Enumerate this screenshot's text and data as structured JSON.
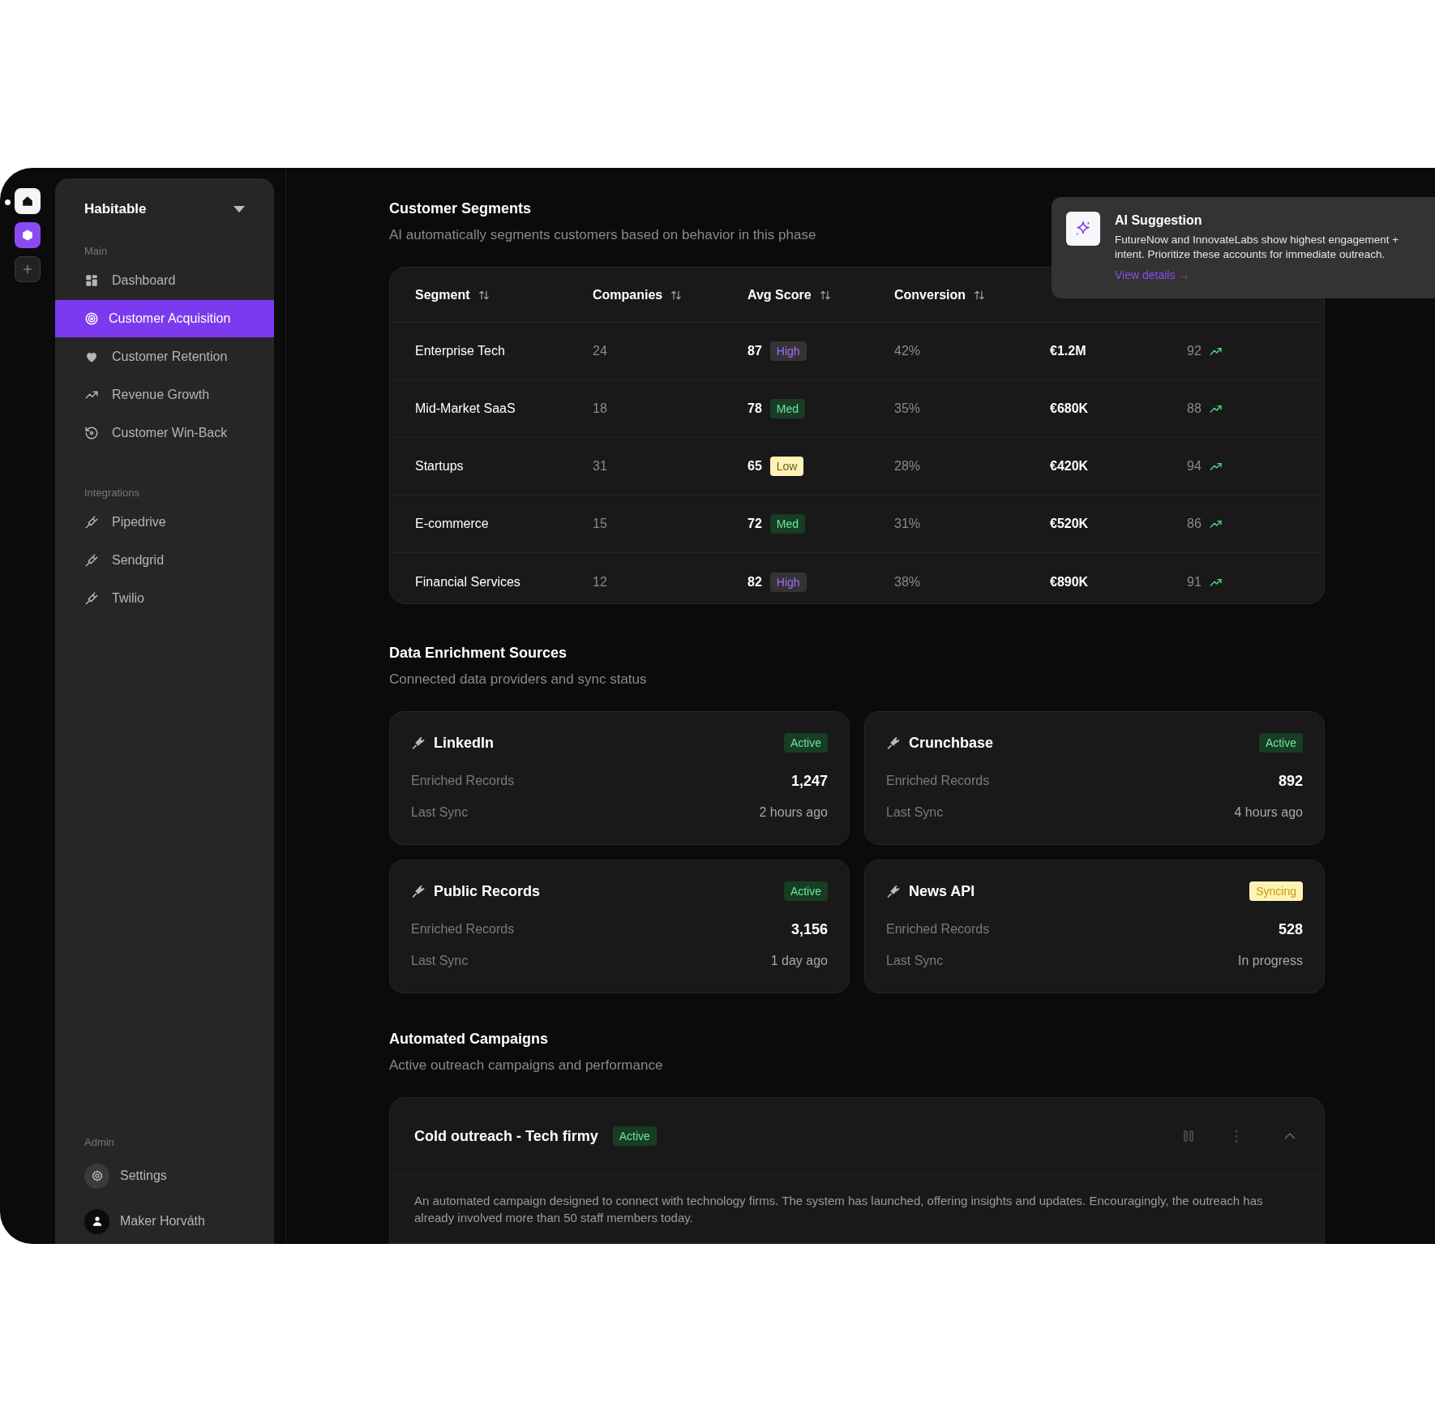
{
  "rail": {
    "items": [
      {
        "kind": "home"
      },
      {
        "kind": "workspace"
      },
      {
        "kind": "add"
      }
    ]
  },
  "sidebar": {
    "workspace": "Habitable",
    "sections": [
      {
        "label": "Main",
        "items": [
          {
            "label": "Dashboard",
            "selected": false
          },
          {
            "label": "Customer Acquisition",
            "selected": true
          },
          {
            "label": "Customer Retention",
            "selected": false
          },
          {
            "label": "Revenue Growth",
            "selected": false
          },
          {
            "label": "Customer Win-Back",
            "selected": false
          }
        ]
      },
      {
        "label": "Integrations",
        "items": [
          {
            "label": "Pipedrive",
            "selected": false
          },
          {
            "label": "Sendgrid",
            "selected": false
          },
          {
            "label": "Twilio",
            "selected": false
          }
        ]
      }
    ],
    "admin": {
      "label": "Admin",
      "items": [
        {
          "label": "Settings"
        },
        {
          "label": "Maker Horváth"
        }
      ]
    }
  },
  "segments": {
    "title": "Customer Segments",
    "subtitle": "AI automatically segments customers based on behavior in this phase",
    "columns": [
      "Segment",
      "Companies",
      "Avg Score",
      "Conversion"
    ],
    "rows": [
      {
        "segment": "Enterprise Tech",
        "companies": "24",
        "score": "87",
        "tag": "High",
        "kind": "high",
        "conversion": "42%",
        "column_5": "€1.2M",
        "column_6": "92"
      },
      {
        "segment": "Mid-Market SaaS",
        "companies": "18",
        "score": "78",
        "tag": "Med",
        "kind": "med",
        "conversion": "35%",
        "column_5": "€680K",
        "column_6": "88"
      },
      {
        "segment": "Startups",
        "companies": "31",
        "score": "65",
        "tag": "Low",
        "kind": "low",
        "conversion": "28%",
        "column_5": "€420K",
        "column_6": "94"
      },
      {
        "segment": "E-commerce",
        "companies": "15",
        "score": "72",
        "tag": "Med",
        "kind": "med",
        "conversion": "31%",
        "column_5": "€520K",
        "column_6": "86"
      },
      {
        "segment": "Financial Services",
        "companies": "12",
        "score": "82",
        "tag": "High",
        "kind": "high",
        "conversion": "38%",
        "column_5": "€890K",
        "column_6": "91"
      }
    ]
  },
  "ai_suggestion": {
    "title": "AI Suggestion",
    "text": "FutureNow and InnovateLabs show highest engagement + intent. Prioritize these accounts for immediate outreach.",
    "link": "View details →"
  },
  "enrichment": {
    "title": "Data Enrichment Sources",
    "subtitle": "Connected data providers and sync status",
    "sources": [
      {
        "name": "LinkedIn",
        "status": "Active",
        "kind": "active",
        "records_label": "Enriched Records",
        "records": "1,247",
        "sync_label": "Last Sync",
        "sync": "2 hours ago"
      },
      {
        "name": "Crunchbase",
        "status": "Active",
        "kind": "active",
        "records_label": "Enriched Records",
        "records": "892",
        "sync_label": "Last Sync",
        "sync": "4 hours ago"
      },
      {
        "name": "Public Records",
        "status": "Active",
        "kind": "active",
        "records_label": "Enriched Records",
        "records": "3,156",
        "sync_label": "Last Sync",
        "sync": "1 day ago"
      },
      {
        "name": "News API",
        "status": "Syncing",
        "kind": "syncing",
        "records_label": "Enriched Records",
        "records": "528",
        "sync_label": "Last Sync",
        "sync": "In progress"
      }
    ]
  },
  "campaigns": {
    "title": "Automated Campaigns",
    "subtitle": "Active outreach campaigns and performance",
    "items": [
      {
        "name": "Cold outreach - Tech firmy",
        "status": "Active",
        "kind": "active",
        "expanded": true,
        "description": "An automated campaign designed to connect with technology firms. The system has launched, offering insights and updates. Encouragingly, the outreach has already involved more than 50 staff members today."
      }
    ]
  }
}
